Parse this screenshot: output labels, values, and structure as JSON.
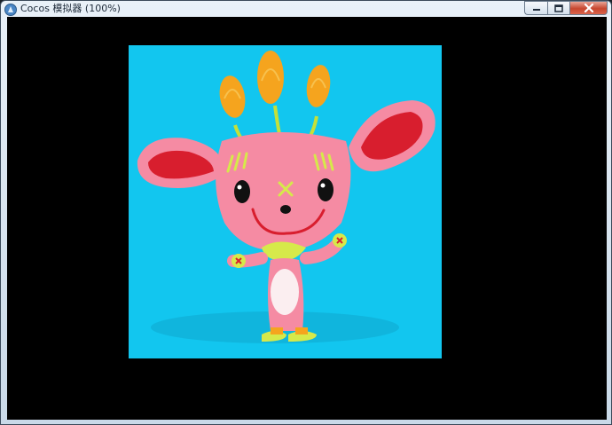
{
  "window": {
    "title": "Cocos 模拟器 (100%)",
    "icon": "cocos-app-icon",
    "controls": [
      "minimize-icon",
      "maximize-icon",
      "close-icon"
    ]
  },
  "scene": {
    "background_color": "#12c6ef",
    "image": "pink-character-illustration"
  },
  "colors": {
    "client_background": "#000000",
    "character_pink": "#f58ba3",
    "ear_inner": "#d81e2e",
    "flower_orange": "#f5a41e",
    "accent_yellow_green": "#d6e94a"
  }
}
